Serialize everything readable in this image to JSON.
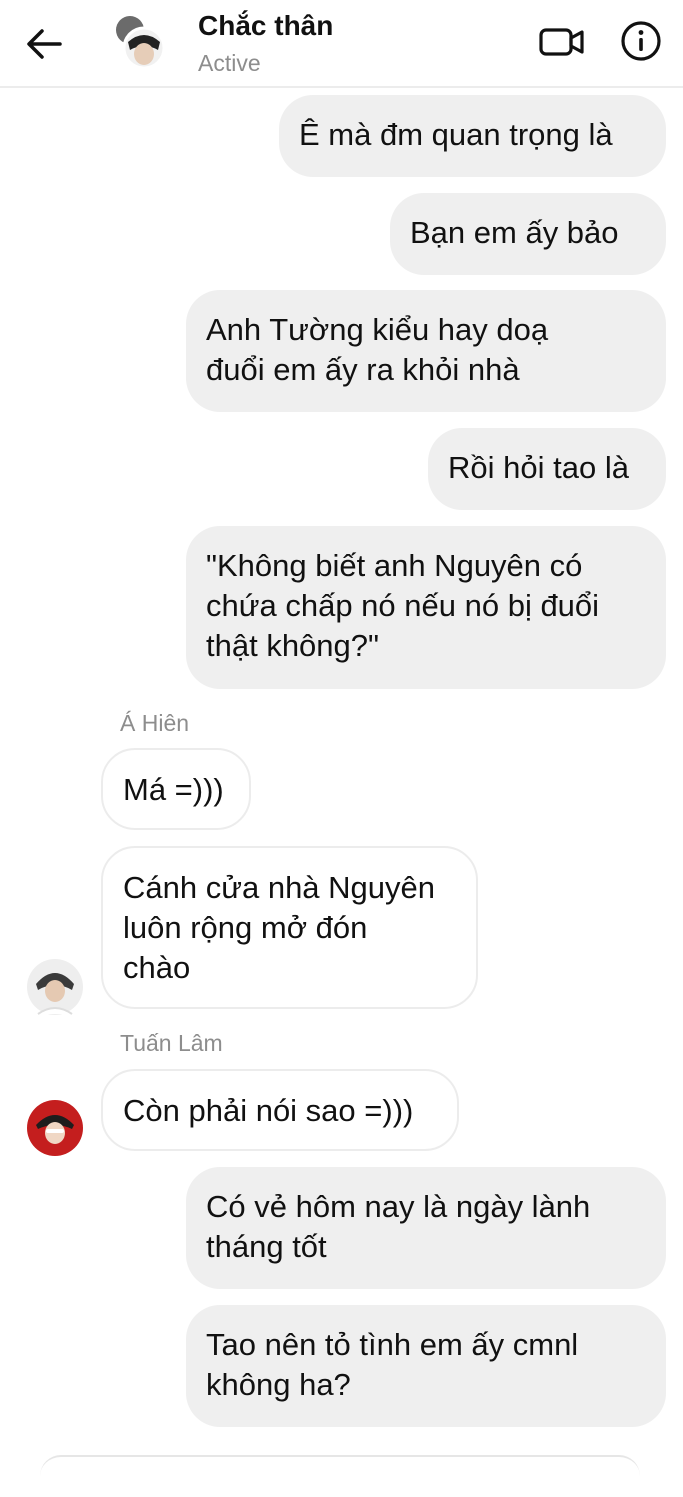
{
  "header": {
    "title": "Chắc thân",
    "status": "Active",
    "back_icon": "arrow-left-icon",
    "video_icon": "video-camera-icon",
    "info_icon": "info-icon"
  },
  "messages": [
    {
      "type": "outgoing",
      "text": "Ê mà đm quan trọng là"
    },
    {
      "type": "outgoing",
      "text": "Bạn em ấy bảo"
    },
    {
      "type": "outgoing",
      "text": "Anh Tường kiểu hay doạ\nđuổi em ấy ra khỏi nhà"
    },
    {
      "type": "outgoing",
      "text": "Rồi hỏi tao là"
    },
    {
      "type": "outgoing",
      "text": "\"Không biết anh Nguyên có\nchứa chấp nó nếu nó bị đuổi\nthật không?\""
    },
    {
      "type": "incoming",
      "sender": "Á Hiên",
      "text": "Má =)))"
    },
    {
      "type": "incoming",
      "text": "Cánh cửa nhà Nguyên\nluôn rộng mở đón\nchào"
    },
    {
      "type": "incoming",
      "sender": "Tuấn Lâm",
      "text": "Còn phải nói sao =)))"
    },
    {
      "type": "outgoing",
      "text": "Có vẻ hôm nay là ngày lành\ntháng tốt"
    },
    {
      "type": "outgoing",
      "text": "Tao nên tỏ tình em ấy cmnl\nkhông ha?"
    }
  ],
  "colors": {
    "outgoing_bubble": "#efefef",
    "incoming_bubble": "#ffffff",
    "muted_text": "#8d8d8d"
  }
}
